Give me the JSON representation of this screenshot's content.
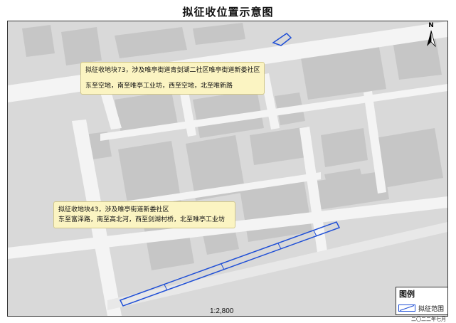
{
  "title": "拟征收位置示意图",
  "callouts": {
    "parcel_73": {
      "line1": "拟征收地块73，涉及唯亭街道青剑湖二社区唯亭街道新娄社区",
      "line2": "东至空地，南至唯亭工业坊，西至空地，北至唯新路"
    },
    "parcel_43": {
      "line1": "拟征收地块43，涉及唯亭街道新娄社区",
      "line2": "东至富泽路，南至高北河，西至剑湖村桥，北至唯亭工业坊"
    }
  },
  "north_arrow": {
    "label": "N",
    "icon": "north-arrow-icon"
  },
  "scale": "1:2,800",
  "legend": {
    "title": "图例",
    "items": [
      {
        "label": "拟征范围",
        "icon": "parcel-outline-icon",
        "color": "#1f4fd6"
      }
    ]
  },
  "date": "二〇二二年七月",
  "colors": {
    "basemap": "#d9d9d9",
    "road": "#f4f4f4",
    "building": "#c6c6c6",
    "callout_fill": "#fbf4c2",
    "parcel_outline": "#1f4fd6"
  }
}
